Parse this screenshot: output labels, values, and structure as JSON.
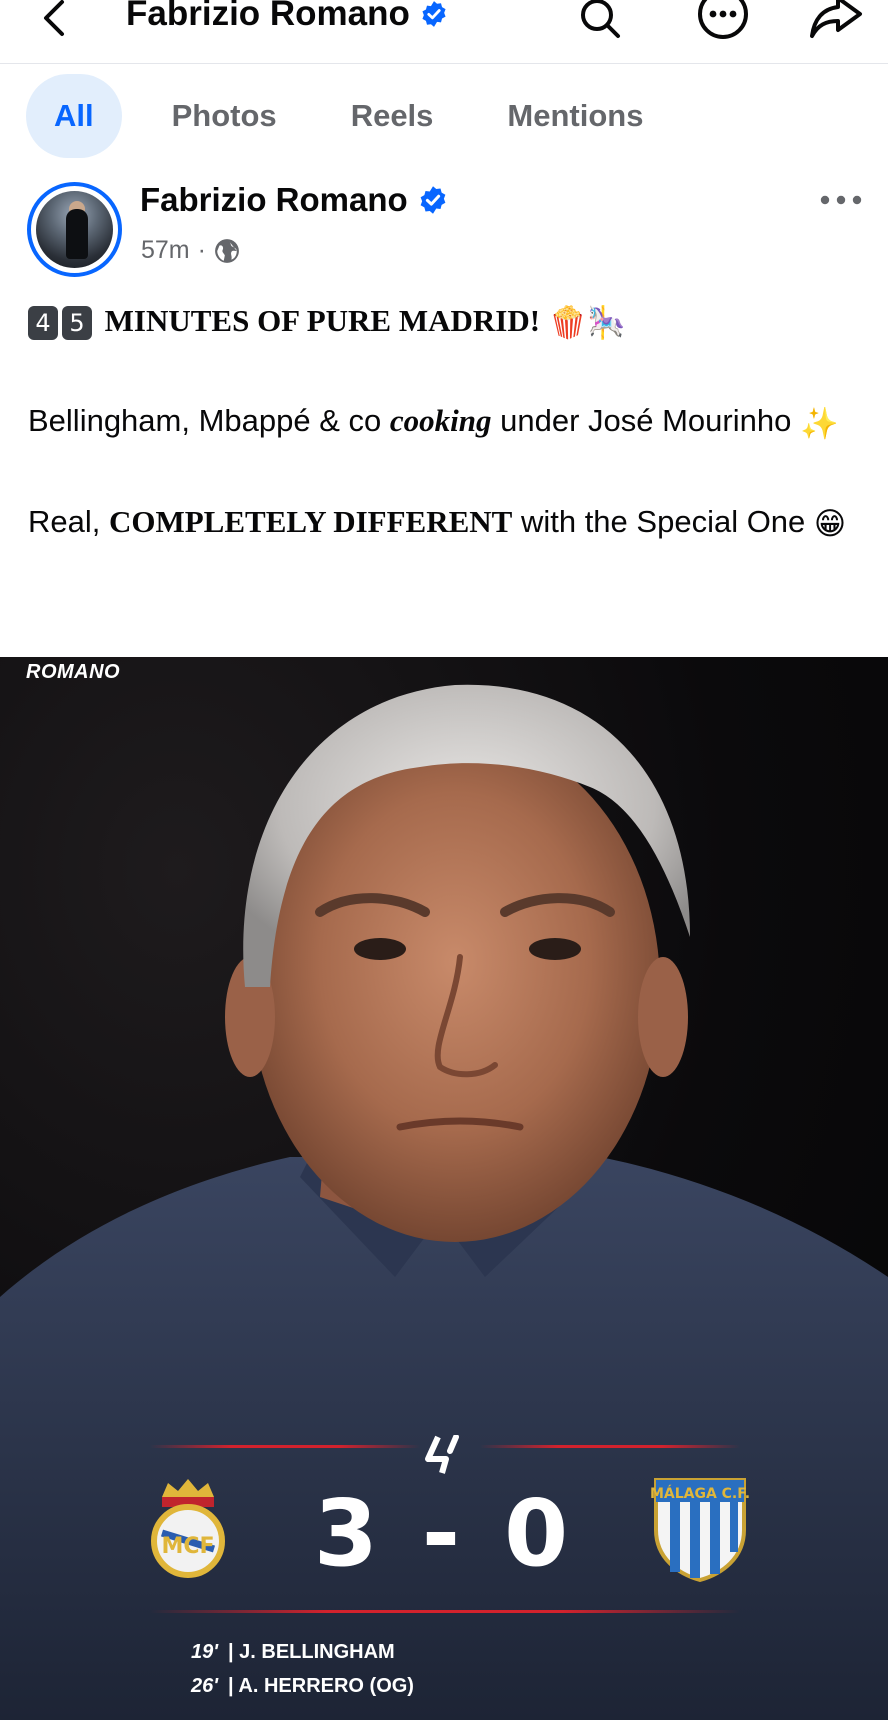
{
  "header": {
    "title": "Fabrizio Romano",
    "icons": [
      "back-chevron-icon",
      "verified-badge-icon",
      "search-icon",
      "more-circle-icon",
      "share-icon"
    ]
  },
  "tabs": [
    {
      "label": "All",
      "active": true
    },
    {
      "label": "Photos",
      "active": false
    },
    {
      "label": "Reels",
      "active": false
    },
    {
      "label": "Mentions",
      "active": false
    }
  ],
  "post": {
    "author": "Fabrizio Romano",
    "time": "57m",
    "separator": "·",
    "audience_icon": "globe-icon",
    "text": {
      "keycap_1": "4",
      "keycap_2": "5",
      "headline": "MINUTES OF PURE MADRID!",
      "headline_emojis": "🍿🎠",
      "line2_a": "Bellingham, Mbappé & co ",
      "line2_b": "cooking",
      "line2_c": " under José Mourinho ",
      "line2_emoji": "✨",
      "line3_a": "Real, ",
      "line3_b": "COMPLETELY DIFFERENT",
      "line3_c": " with the Special One ",
      "line3_emoji": "😁"
    },
    "image": {
      "watermark": "ROMANO",
      "home_score": "3",
      "dash": "-",
      "away_score": "0",
      "scorers": [
        {
          "minute": "19'",
          "name": "| J. BELLINGHAM"
        },
        {
          "minute": "26'",
          "name": "| A. HERRERO (OG)"
        }
      ],
      "accent_color": "#d2222d"
    }
  },
  "colors": {
    "brand_blue": "#0866ff",
    "tab_active_bg": "#e2eefc",
    "secondary_text": "#65676b"
  }
}
